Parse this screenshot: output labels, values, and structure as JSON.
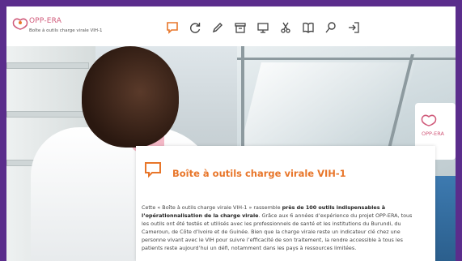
{
  "logo": {
    "name": "OPP-ERA",
    "subtitle": "Boîte à outils charge virale VIH-1"
  },
  "toolbar": {
    "icons": [
      "chat-bubble-icon",
      "refresh-icon",
      "pencil-icon",
      "archive-icon",
      "monitor-icon",
      "scissors-icon",
      "book-icon",
      "search-icon",
      "logout-icon"
    ]
  },
  "photo": {
    "sticker_text": "OPP-ERA"
  },
  "card": {
    "title": "Boîte à outils charge virale VIH-1",
    "body_part1": "Cette « Boîte à outils charge virale VIH-1 » rassemble ",
    "body_bold1": "près de 100 outils indispensables à l’opérationnalisation de la charge virale",
    "body_part2": ". Grâce aux 6 années d’expérience du projet OPP-ERA, tous les outils ont été testés et utilisés avec les professionnels de santé et les institutions du Burundi, du Cameroun, de Côte d’Ivoire et de Guinée. Bien que la charge virale reste un indicateur clé chez une personne vivant avec le VIH pour suivre l’efficacité de son traitement, la rendre accessible à tous les patients reste aujourd’hui un défi, notamment dans les pays à ressources limitées."
  },
  "colors": {
    "accent": "#e8762a",
    "brand": "#d05a7a",
    "border": "#5b2d8c"
  }
}
